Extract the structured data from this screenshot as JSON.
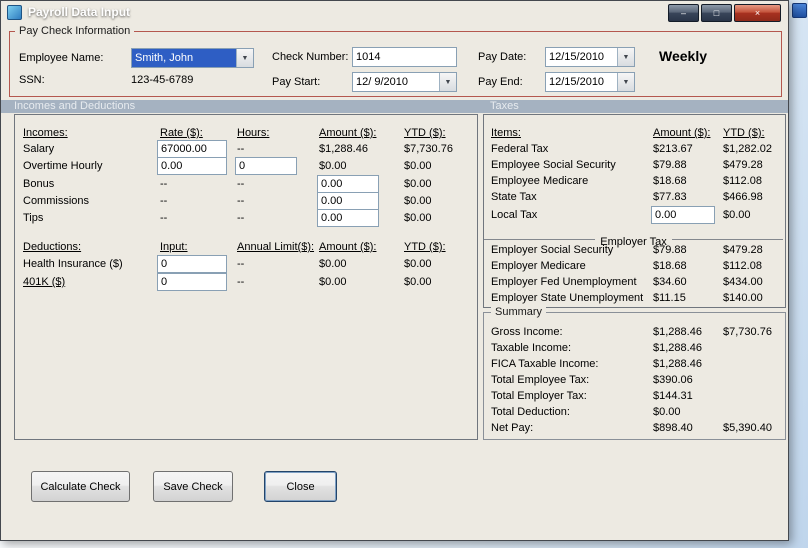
{
  "window": {
    "title": "Payroll Data Input",
    "controls": {
      "minimize": "–",
      "maximize": "□",
      "close": "×"
    }
  },
  "colors": {
    "titlebar_top": "#76879C",
    "titlebar_bottom": "#101B2E",
    "close_button_red": "#A83220",
    "group_border_red": "#B4574E",
    "section_band": "#A5B2C1",
    "selection_blue": "#2E5EC4",
    "window_bg": "#EDEAE2"
  },
  "paycheck": {
    "legend": "Pay Check Information",
    "employee_name": {
      "label": "Employee Name:",
      "value": "Smith, John"
    },
    "ssn": {
      "label": "SSN:",
      "value": "123-45-6789"
    },
    "check_number": {
      "label": "Check Number:",
      "value": "1014"
    },
    "pay_start": {
      "label": "Pay Start:",
      "value": "12/ 9/2010"
    },
    "pay_date": {
      "label": "Pay Date:",
      "value": "12/15/2010"
    },
    "pay_end": {
      "label": "Pay End:",
      "value": "12/15/2010"
    },
    "frequency": "Weekly"
  },
  "section_headers": {
    "left": "Incomes and Deductions",
    "right": "Taxes"
  },
  "incomes": {
    "headers": {
      "name": "Incomes:",
      "rate": "Rate ($):",
      "hours": "Hours:",
      "amount": "Amount ($):",
      "ytd": "YTD ($):"
    },
    "rows": [
      {
        "label": "Salary",
        "rate": "67000.00",
        "hours": "--",
        "amount": "$1,288.46",
        "ytd": "$7,730.76"
      },
      {
        "label": "Overtime Hourly",
        "rate": "0.00",
        "hours": "0",
        "amount": "$0.00",
        "ytd": "$0.00"
      },
      {
        "label": "Bonus",
        "rate": "--",
        "hours": "--",
        "amount": "0.00",
        "ytd": "$0.00"
      },
      {
        "label": "Commissions",
        "rate": "--",
        "hours": "--",
        "amount": "0.00",
        "ytd": "$0.00"
      },
      {
        "label": "Tips",
        "rate": "--",
        "hours": "--",
        "amount": "0.00",
        "ytd": "$0.00"
      }
    ]
  },
  "deductions": {
    "headers": {
      "name": "Deductions:",
      "input": "Input:",
      "limit": "Annual Limit($):",
      "amount": "Amount ($):",
      "ytd": "YTD ($):"
    },
    "rows": [
      {
        "label": "Health Insurance  ($)",
        "input": "0",
        "limit": "--",
        "amount": "$0.00",
        "ytd": "$0.00"
      },
      {
        "label": "401K  ($)",
        "input": "0",
        "limit": "--",
        "amount": "$0.00",
        "ytd": "$0.00"
      }
    ]
  },
  "taxes": {
    "headers": {
      "items": "Items:",
      "amount": "Amount ($):",
      "ytd": "YTD ($):"
    },
    "employee_rows": [
      {
        "label": "Federal Tax",
        "amount": "$213.67",
        "ytd": "$1,282.02"
      },
      {
        "label": "Employee Social Security",
        "amount": "$79.88",
        "ytd": "$479.28"
      },
      {
        "label": "Employee Medicare",
        "amount": "$18.68",
        "ytd": "$112.08"
      },
      {
        "label": "State Tax",
        "amount": "$77.83",
        "ytd": "$466.98"
      },
      {
        "label": "Local Tax",
        "amount": "0.00",
        "ytd": "$0.00"
      }
    ],
    "employer_header": "Employer Tax",
    "employer_rows": [
      {
        "label": "Employer Social Security",
        "amount": "$79.88",
        "ytd": "$479.28"
      },
      {
        "label": "Employer Medicare",
        "amount": "$18.68",
        "ytd": "$112.08"
      },
      {
        "label": "Employer Fed Unemployment",
        "amount": "$34.60",
        "ytd": "$434.00"
      },
      {
        "label": "Employer State Unemployment",
        "amount": "$11.15",
        "ytd": "$140.00"
      }
    ]
  },
  "summary": {
    "legend": "Summary",
    "rows": [
      {
        "label": "Gross Income:",
        "amount": "$1,288.46",
        "ytd": "$7,730.76"
      },
      {
        "label": "Taxable Income:",
        "amount": "$1,288.46",
        "ytd": ""
      },
      {
        "label": "FICA Taxable Income:",
        "amount": "$1,288.46",
        "ytd": ""
      },
      {
        "label": "Total Employee Tax:",
        "amount": "$390.06",
        "ytd": ""
      },
      {
        "label": "Total Employer Tax:",
        "amount": "$144.31",
        "ytd": ""
      },
      {
        "label": "Total Deduction:",
        "amount": "$0.00",
        "ytd": ""
      },
      {
        "label": "Net Pay:",
        "amount": "$898.40",
        "ytd": "$5,390.40"
      }
    ]
  },
  "buttons": {
    "calculate": "Calculate Check",
    "save": "Save Check",
    "close": "Close"
  }
}
